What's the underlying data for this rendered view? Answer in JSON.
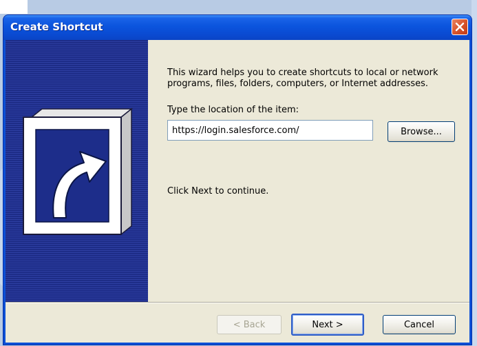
{
  "window": {
    "title": "Create Shortcut"
  },
  "wizard": {
    "intro": "This wizard helps you to create shortcuts to local or network programs, files, folders, computers, or Internet addresses.",
    "location_label": "Type the location of the item:",
    "location_value": "https://login.salesforce.com/",
    "browse_label": "Browse...",
    "continue_text": "Click Next to continue."
  },
  "buttons": {
    "back_label": "< Back",
    "next_label": "Next >",
    "cancel_label": "Cancel"
  },
  "icons": {
    "close": "close-icon",
    "shortcut_art": "shortcut-arrow-icon"
  },
  "colors": {
    "titlebar": "#0a54dd",
    "sidebar": "#1d2d8a",
    "dialog_bg": "#ece9d8",
    "close_button": "#d9562d"
  }
}
